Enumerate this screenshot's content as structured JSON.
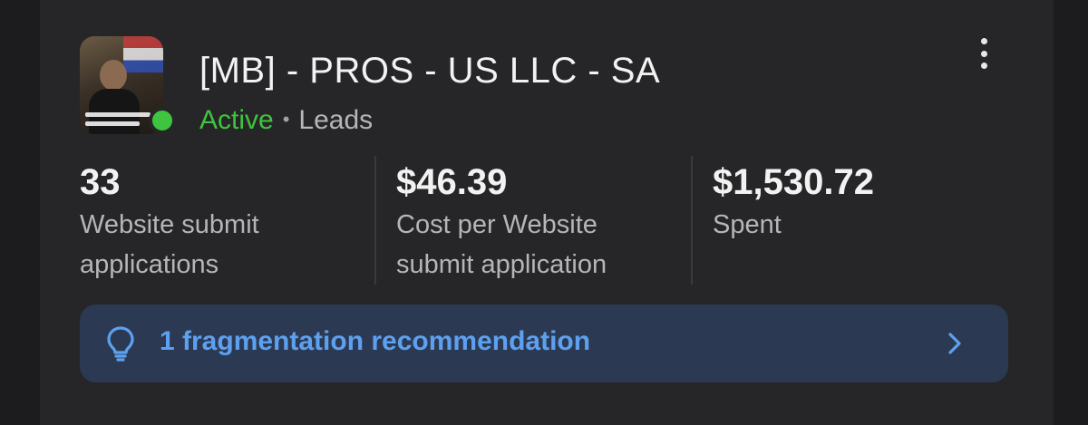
{
  "campaign": {
    "title": "[MB] - PROS - US LLC - SA",
    "status": "Active",
    "separator": "•",
    "objective": "Leads",
    "thumbnail_icon": "ad-creative-thumbnail",
    "status_color": "#3ec43e",
    "more_icon": "kebab-menu-icon"
  },
  "metrics": [
    {
      "value": "33",
      "label_line1": "Website submit",
      "label_line2": "applications"
    },
    {
      "value": "$46.39",
      "label_line1": "Cost per Website",
      "label_line2": "submit application"
    },
    {
      "value": "$1,530.72",
      "label_line1": "Spent",
      "label_line2": ""
    }
  ],
  "recommendation": {
    "text": "1 fragmentation recommendation",
    "icon": "lightbulb-icon",
    "chevron": "chevron-right-icon",
    "accent": "#5ea0f0"
  }
}
